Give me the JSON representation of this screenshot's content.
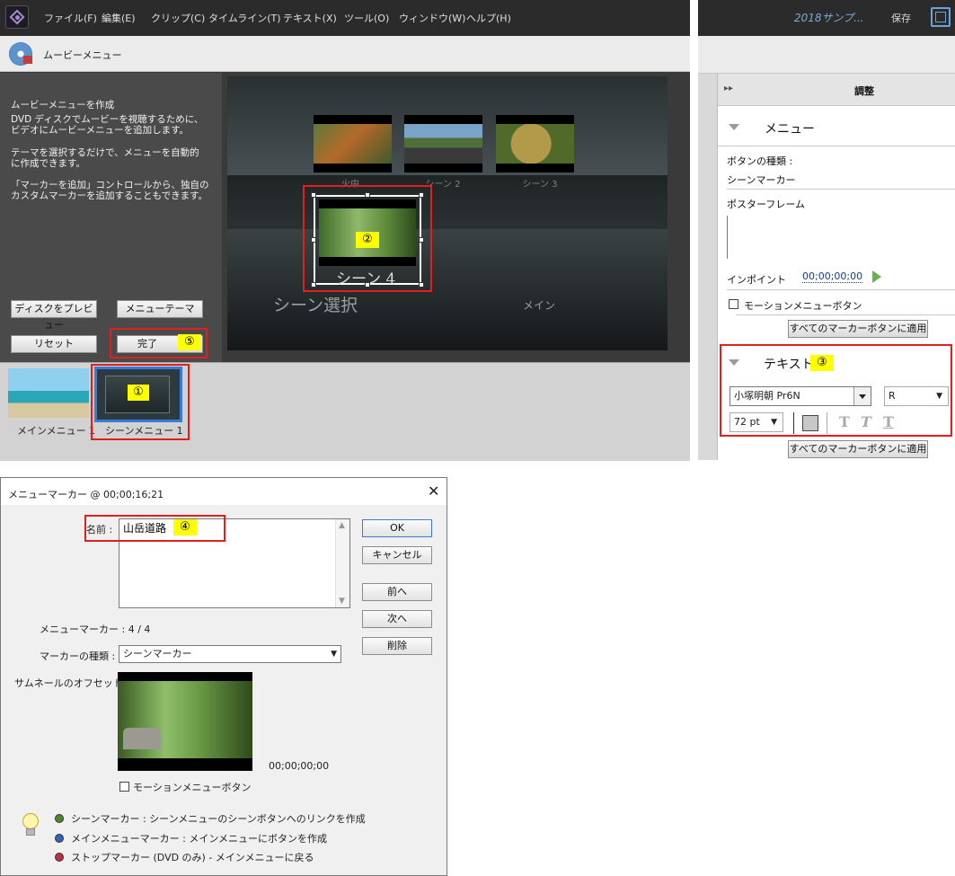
{
  "app": {
    "menu": [
      "ファイル(F)",
      "編集(E)",
      "クリップ(C)",
      "タイムライン(T)",
      "テキスト(X)",
      "ツール(O)",
      "ウィンドウ(W)",
      "ヘルプ(H)"
    ],
    "project_title": "2018サンプ...",
    "save_label": "保存"
  },
  "movie_menu": {
    "panel_title": "ムービーメニュー",
    "description": [
      "ムービーメニューを作成",
      "DVD ディスクでムービーを視聴するために、",
      "ビデオにムービーメニューを追加します。",
      "テーマを選択するだけで、メニューを自動的",
      "に作成できます。",
      "「マーカーを追加」コントロールから、独自の",
      "カスタムマーカーを追加することもできます。"
    ],
    "buttons": {
      "preview_disc": "ディスクをプレビュー",
      "menu_theme": "メニューテーマ",
      "reset": "リセット",
      "done": "完了"
    },
    "preview": {
      "thumb_captions": [
        "火中",
        "シーン 2",
        "シーン 3"
      ],
      "selected_caption": "シーン 4",
      "scene_select": "シーン選択",
      "main": "メイン"
    },
    "menus": [
      {
        "label": "メインメニュー 1"
      },
      {
        "label": "シーンメニュー 1"
      }
    ]
  },
  "adjust": {
    "title": "調整",
    "menu_section": "メニュー",
    "button_type_label": "ボタンの種類 :",
    "button_type_value": "シーンマーカー",
    "poster_frame": "ポスターフレーム",
    "in_point_label": "インポイント",
    "in_point_value": "00;00;00;00",
    "motion_menu_button": "モーションメニューボタン",
    "apply_all": "すべてのマーカーボタンに適用",
    "text_section": "テキスト",
    "font": "小塚明朝 Pr6N",
    "font_style": "R",
    "font_size": "72 pt",
    "apply_all_2": "すべてのマーカーボタンに適用"
  },
  "dialog": {
    "title": "メニューマーカー @ 00;00;16;21",
    "name_label": "名前 :",
    "name_value": "山岳道路",
    "marker_count_label": "メニューマーカー : 4 / 4",
    "marker_type_label": "マーカーの種類 :",
    "marker_type_value": "シーンマーカー",
    "thumb_offset_label": "サムネールのオフセット :",
    "thumb_timecode": "00;00;00;00",
    "motion_menu_button": "モーションメニューボタン",
    "buttons": {
      "ok": "OK",
      "cancel": "キャンセル",
      "prev": "前へ",
      "next": "次へ",
      "delete": "削除"
    },
    "legend": [
      "シーンマーカー : シーンメニューのシーンボタンへのリンクを作成",
      "メインメニューマーカー : メインメニューにボタンを作成",
      "ストップマーカー (DVD のみ) - メインメニューに戻る"
    ],
    "legend_colors": [
      "#4a8a2a",
      "#2f62b8",
      "#c0303a"
    ]
  },
  "callouts": [
    "①",
    "②",
    "③",
    "④",
    "⑤"
  ],
  "colors": {
    "callout_border": "#e0201f",
    "badge_bg": "#ffff00",
    "accent_blue": "#3a7bd5"
  }
}
